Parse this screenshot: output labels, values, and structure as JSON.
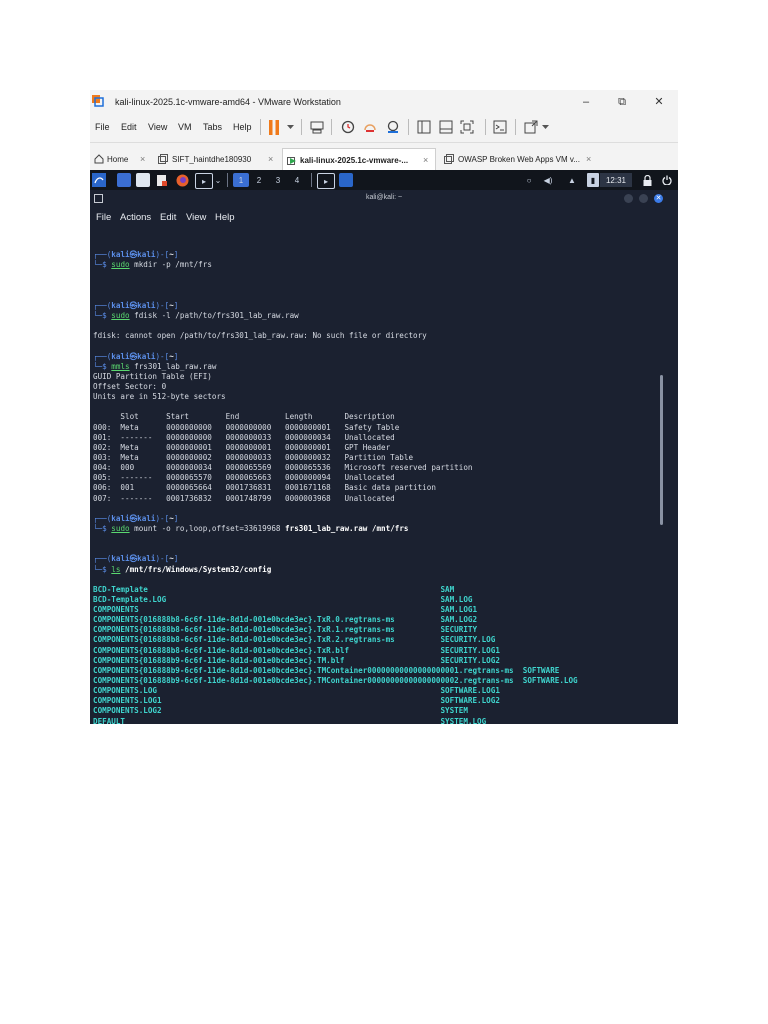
{
  "window": {
    "title": "kali-linux-2025.1c-vmware-amd64 - VMware Workstation",
    "controls": {
      "minimize": "–",
      "maximize": "⧉",
      "close": "✕"
    }
  },
  "menubar": [
    "File",
    "Edit",
    "View",
    "VM",
    "Tabs",
    "Help"
  ],
  "toolbar_icons": [
    "pause-icon",
    "dropdown-icon",
    "send-ctrl-alt-del-icon",
    "snapshot-icon",
    "revert-snapshot-icon",
    "snapshot-manager-icon",
    "library-icon",
    "thumbnail-icon",
    "fullscreen-icon",
    "console-icon",
    "stretch-icon"
  ],
  "tabs": [
    {
      "label": "Home",
      "close": "×"
    },
    {
      "label": "SIFT_haintdhe180930",
      "close": "×"
    },
    {
      "label": "kali-linux-2025.1c-vmware-...",
      "close": "×"
    },
    {
      "label": "OWASP Broken Web Apps VM v...",
      "close": "×"
    }
  ],
  "kali_panel": {
    "workspaces": [
      "1",
      "2",
      "3",
      "4"
    ],
    "clock": "12:31"
  },
  "terminal": {
    "title": "kali@kali: ~",
    "menu": [
      "File",
      "Actions",
      "Edit",
      "View",
      "Help"
    ],
    "prompt": {
      "top": "┌──(",
      "user": "kali㉿kali",
      "mid": ")-[",
      "path": "~",
      "end": "]",
      "bottom": "└─$ "
    },
    "commands": [
      {
        "cmd": "sudo",
        "args": " mkdir -p /mnt/frs"
      },
      {
        "cmd": "sudo",
        "args": " fdisk -l /path/to/frs301_lab_raw.raw"
      },
      {
        "cmd": "mmls",
        "args": " frs301_lab_raw.raw"
      },
      {
        "cmd": "sudo",
        "args": " mount -o ro,loop,offset=33619968 ",
        "bold": "frs301_lab_raw.raw /mnt/frs"
      },
      {
        "cmd": "ls",
        "args": " ",
        "bold": "/mnt/frs/Windows/System32/config"
      }
    ],
    "fdisk_error": "fdisk: cannot open /path/to/frs301_lab_raw.raw: No such file or directory",
    "mmls_header": [
      "GUID Partition Table (EFI)",
      "Offset Sector: 0",
      "Units are in 512-byte sectors"
    ],
    "mmls_table_header": "      Slot      Start        End          Length       Description",
    "mmls_rows": [
      "000:  Meta      0000000000   0000000000   0000000001   Safety Table",
      "001:  -------   0000000000   0000000033   0000000034   Unallocated",
      "002:  Meta      0000000001   0000000001   0000000001   GPT Header",
      "003:  Meta      0000000002   0000000033   0000000032   Partition Table",
      "004:  000       0000000034   0000065569   0000065536   Microsoft reserved partition",
      "005:  -------   0000065570   0000065663   0000000094   Unallocated",
      "006:  001       0000065664   0001736831   0001671168   Basic data partition",
      "007:  -------   0001736832   0001748799   0000003968   Unallocated"
    ],
    "ls_left": [
      "BCD-Template",
      "BCD-Template.LOG",
      "COMPONENTS",
      "COMPONENTS{016888b8-6c6f-11de-8d1d-001e0bcde3ec}.TxR.0.regtrans-ms",
      "COMPONENTS{016888b8-6c6f-11de-8d1d-001e0bcde3ec}.TxR.1.regtrans-ms",
      "COMPONENTS{016888b8-6c6f-11de-8d1d-001e0bcde3ec}.TxR.2.regtrans-ms",
      "COMPONENTS{016888b8-6c6f-11de-8d1d-001e0bcde3ec}.TxR.blf",
      "COMPONENTS{016888b9-6c6f-11de-8d1d-001e0bcde3ec}.TM.blf",
      "COMPONENTS{016888b9-6c6f-11de-8d1d-001e0bcde3ec}.TMContainer00000000000000000001.regtrans-ms",
      "COMPONENTS{016888b9-6c6f-11de-8d1d-001e0bcde3ec}.TMContainer00000000000000000002.regtrans-ms",
      "COMPONENTS.LOG",
      "COMPONENTS.LOG1",
      "COMPONENTS.LOG2",
      "DEFAULT"
    ],
    "ls_right": [
      "SAM",
      "SAM.LOG",
      "SAM.LOG1",
      "SAM.LOG2",
      "SECURITY",
      "SECURITY.LOG",
      "SECURITY.LOG1",
      "SECURITY.LOG2",
      "SOFTWARE",
      "SOFTWARE.LOG",
      "SOFTWARE.LOG1",
      "SOFTWARE.LOG2",
      "SYSTEM",
      "SYSTEM.LOG"
    ]
  },
  "colors": {
    "terminal_bg": "#1b2130",
    "prompt_blue": "#5b8ee8",
    "command_green": "#5ad86f",
    "listing_cyan": "#3fd5ce",
    "pause_orange": "#f07a1a"
  }
}
